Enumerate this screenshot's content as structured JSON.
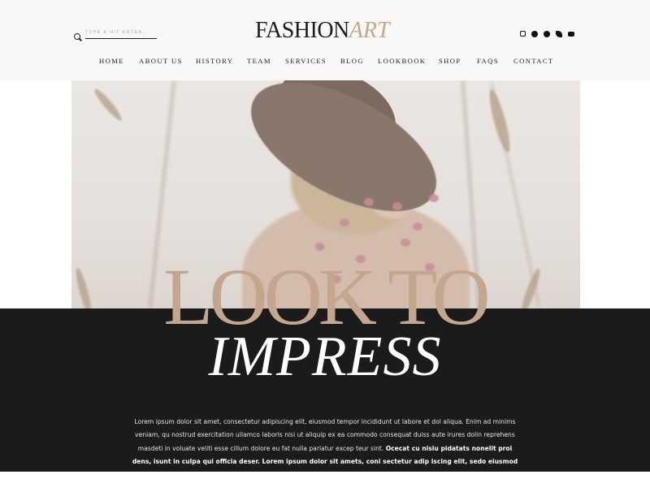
{
  "header": {
    "search_placeholder": "TYPE & HIT ENTER...",
    "logo_primary": "FASHION",
    "logo_accent": "ART",
    "social": [
      "instagram-icon",
      "pinterest-icon",
      "facebook-icon",
      "twitter-icon",
      "youtube-icon"
    ]
  },
  "nav": {
    "items": [
      "HOME",
      "ABOUT US",
      "HISTORY",
      "TEAM",
      "SERVICES",
      "BLOG",
      "LOOKBOOK",
      "SHOP",
      "FAQS",
      "CONTACT"
    ]
  },
  "hero": {
    "title_line1": "LOOK TO",
    "title_line2": "IMPRESS"
  },
  "intro": {
    "text_regular": "Lorem ipsum dolor sit amet, consectetur adipiscing elit, eiusmod tempor incididunt ut labore et dol aliqua. Enim ad minims veniam, qu nostrud exercitation ullamco laboris nisi ut aliquip ex ea commodo consequat duiss aute irures dolin reprehens masdeti in voluate veliti esse cillum dolore eu fat nulla pariatur excep teur sint.",
    "text_bold": "Ocecat cu nisiu pidatats nonelit proi dens, isunt in culpa qui officia deser. Lorem ipsum dolor sit amets, coni sectetur adip iscing elit, sedo eiusmod tempora pari elit proidents, isunti in culpa qui officia deseri nonelit proi dent, sunt in culpa qui offici."
  },
  "colors": {
    "accent": "#c4a58d",
    "dark": "#1b1b1b",
    "header_bg": "#f9f8f7"
  }
}
